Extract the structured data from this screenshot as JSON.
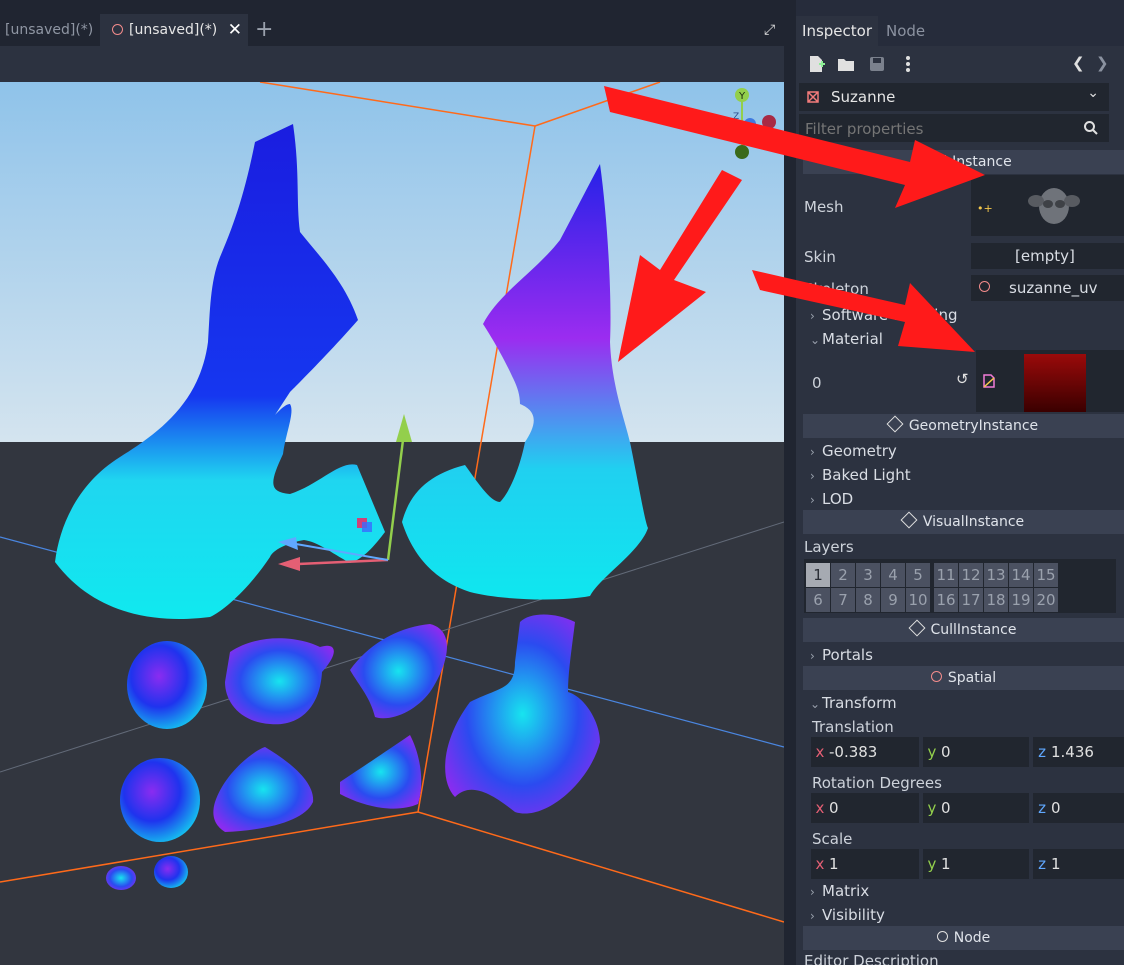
{
  "tabs": {
    "items": [
      {
        "label": "[unsaved](*)"
      },
      {
        "label": "[unsaved](*)"
      }
    ],
    "close_symbol": "✕",
    "add_symbol": "+",
    "fullscreen_symbol": "⤢"
  },
  "dock": {
    "tab_inspector": "Inspector",
    "tab_node": "Node"
  },
  "toolbar": {
    "icons": [
      "new-resource-icon",
      "open-folder-icon",
      "save-icon",
      "kebab-menu-icon"
    ],
    "history_back": "❮",
    "history_forward": "❯"
  },
  "object": {
    "name": "Suzanne",
    "dropdown_symbol": "⌄"
  },
  "filter": {
    "placeholder": "Filter properties"
  },
  "mesh_instance": {
    "section": "MeshInstance",
    "mesh_label": "Mesh",
    "skin_label": "Skin",
    "skin_value": "[empty]",
    "skeleton_label": "Skeleton",
    "skeleton_value": "suzanne_uv",
    "software_skinning_label": "Software Skinning",
    "material_label": "Material",
    "material_index": "0"
  },
  "geometry_instance": {
    "section": "GeometryInstance",
    "items": [
      "Geometry",
      "Baked Light",
      "LOD"
    ]
  },
  "visual_instance": {
    "section": "VisualInstance",
    "layers_label": "Layers",
    "layers": [
      "1",
      "2",
      "3",
      "4",
      "5",
      "11",
      "12",
      "13",
      "14",
      "15",
      "6",
      "7",
      "8",
      "9",
      "10",
      "16",
      "17",
      "18",
      "19",
      "20"
    ]
  },
  "cull_instance": {
    "section": "CullInstance",
    "items": [
      "Portals"
    ]
  },
  "spatial": {
    "section": "Spatial",
    "transform_label": "Transform",
    "translation_label": "Translation",
    "translation": {
      "x": "-0.383",
      "y": "0",
      "z": "1.436"
    },
    "rotation_label": "Rotation Degrees",
    "rotation": {
      "x": "0",
      "y": "0",
      "z": "0"
    },
    "scale_label": "Scale",
    "scale": {
      "x": "1",
      "y": "1",
      "z": "1"
    },
    "items": [
      "Matrix",
      "Visibility"
    ]
  },
  "node": {
    "section": "Node",
    "editor_description_label": "Editor Description"
  },
  "axis_letters": {
    "x": "x",
    "y": "y",
    "z": "z"
  },
  "gizmo": {
    "y_letter": "Y",
    "z_letter": "Z"
  },
  "colors": {
    "accent_red": "#ff1a1a",
    "axis_x": "#e45f74",
    "axis_y": "#93cf4c",
    "axis_z": "#60a8ff",
    "sky": "#a9cce8",
    "ground": "#32363f"
  }
}
